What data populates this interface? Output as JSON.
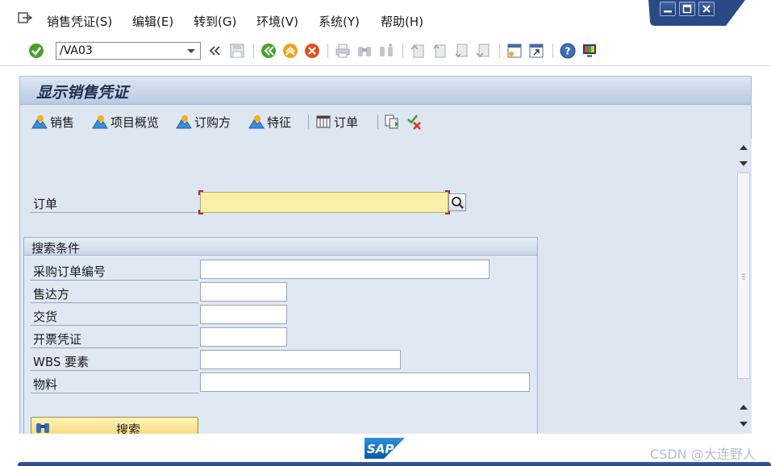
{
  "menu": {
    "items": [
      {
        "label": "销售凭证(S)"
      },
      {
        "label": "编辑(E)"
      },
      {
        "label": "转到(G)"
      },
      {
        "label": "环境(V)"
      },
      {
        "label": "系统(Y)"
      },
      {
        "label": "帮助(H)"
      }
    ]
  },
  "toolbar": {
    "command_value": "/VA03"
  },
  "screen": {
    "title": "显示销售凭证"
  },
  "app_toolbar": {
    "buttons": [
      {
        "label": "销售",
        "icon": "mountain-icon"
      },
      {
        "label": "项目概览",
        "icon": "mountain-icon"
      },
      {
        "label": "订购方",
        "icon": "mountain-icon"
      },
      {
        "label": "特征",
        "icon": "mountain-icon"
      },
      {
        "label": "订单",
        "icon": "table-icon"
      }
    ]
  },
  "order_field": {
    "label": "订单",
    "value": ""
  },
  "search_group": {
    "title": "搜索条件",
    "fields": [
      {
        "label": "采购订单编号",
        "value": ""
      },
      {
        "label": "售达方",
        "value": ""
      },
      {
        "label": "交货",
        "value": ""
      },
      {
        "label": "开票凭证",
        "value": ""
      },
      {
        "label": "WBS 要素",
        "value": ""
      },
      {
        "label": "物料",
        "value": ""
      }
    ],
    "search_button": "搜索"
  },
  "footer": {
    "logo_text": "SAP",
    "watermark": "CSDN @大连野人"
  },
  "colors": {
    "header_band": "#2a4a86",
    "required_field": "#fbefa8",
    "panel_bg": "#dde6f1",
    "button_yellow": "#f6d877"
  }
}
